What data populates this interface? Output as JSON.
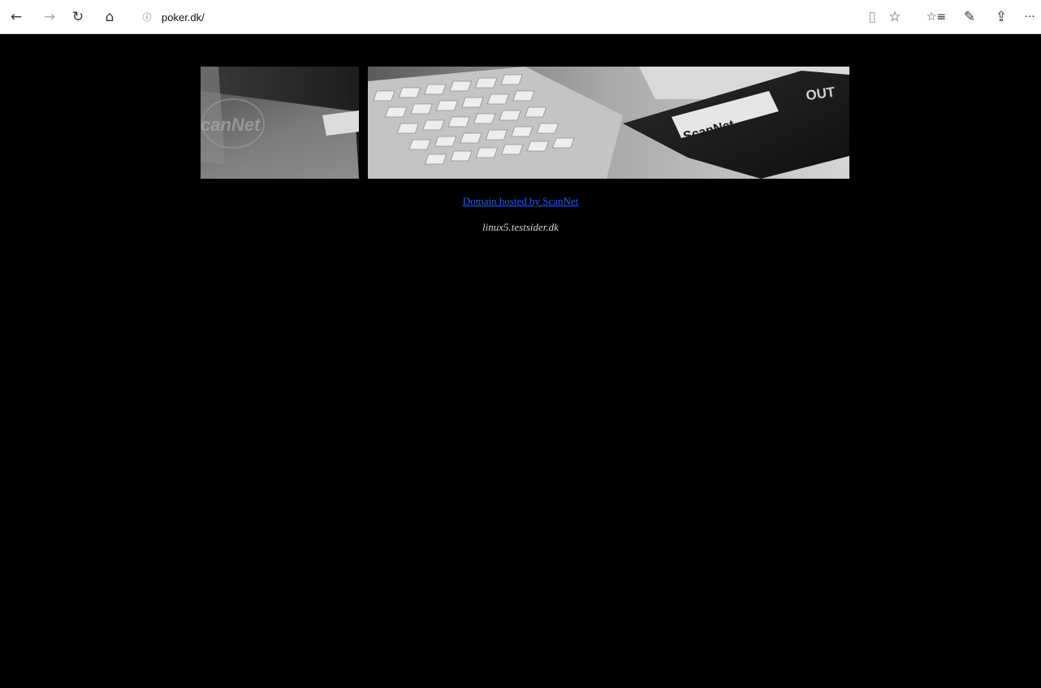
{
  "browser": {
    "url": "poker.dk/",
    "icons": {
      "back": "←",
      "forward": "→",
      "refresh": "↻",
      "home": "⌂",
      "info": "ⓘ",
      "reading_view": "▯",
      "favorite": "☆",
      "favorites_list": "☆≡",
      "pen": "✎",
      "share": "⇪",
      "more": "···"
    }
  },
  "page": {
    "banner": {
      "logo_left": "canNet",
      "logo_card": "ScanNet",
      "corner_text": "OUT"
    },
    "link_text": "Domain hosted by ScanNet",
    "host_text": "linux5.testsider.dk"
  }
}
